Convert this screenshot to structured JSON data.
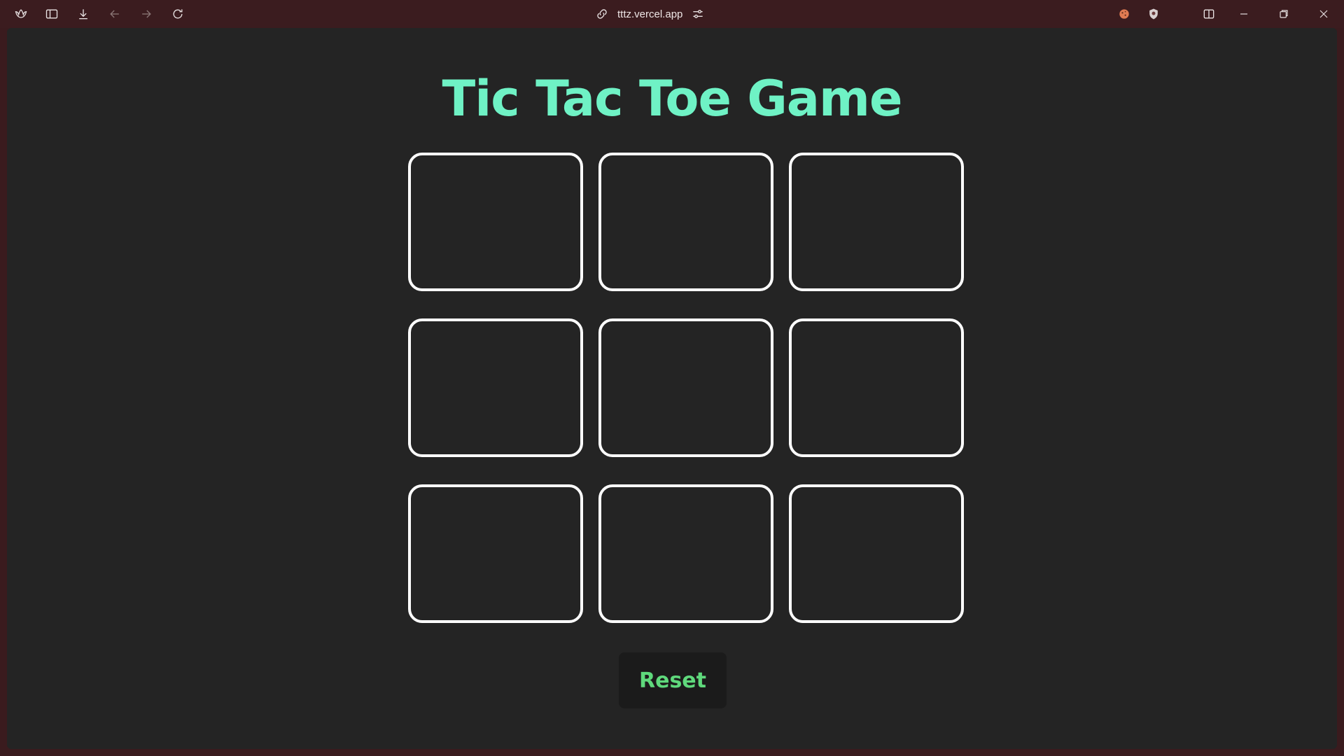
{
  "browser": {
    "url": "tttz.vercel.app",
    "icons": {
      "logo": "browser-logo-icon",
      "sidebar": "sidebar-toggle-icon",
      "download": "download-icon",
      "back": "back-arrow-icon",
      "forward": "forward-arrow-icon",
      "reload": "reload-icon",
      "link": "link-icon",
      "site_settings": "site-settings-icon",
      "cookie": "cookie-icon",
      "shield": "shield-icon",
      "split": "split-view-icon",
      "minimize": "minimize-icon",
      "restore": "restore-icon",
      "close": "close-icon"
    }
  },
  "game": {
    "title": "Tic Tac Toe Game",
    "cells": [
      "",
      "",
      "",
      "",
      "",
      "",
      "",
      "",
      ""
    ],
    "reset_label": "Reset",
    "colors": {
      "title": "#6ff2c5",
      "reset_text": "#5fd97c",
      "cell_border": "#ffffff",
      "background": "#242424"
    }
  }
}
